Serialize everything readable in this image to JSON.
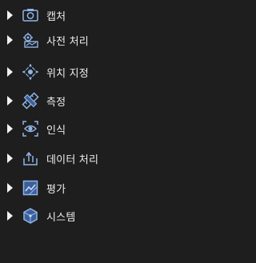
{
  "tree": {
    "items": [
      {
        "label": "캡처",
        "icon": "camera-icon"
      },
      {
        "label": "사전 처리",
        "icon": "preprocess-icon"
      },
      {
        "label": "위치 지정",
        "icon": "locate-icon"
      },
      {
        "label": "측정",
        "icon": "measure-icon"
      },
      {
        "label": "인식",
        "icon": "eye-icon"
      },
      {
        "label": "데이터 처리",
        "icon": "data-export-icon"
      },
      {
        "label": "평가",
        "icon": "evaluate-icon"
      },
      {
        "label": "시스템",
        "icon": "system-icon"
      }
    ]
  },
  "colors": {
    "background": "#1e1e1e",
    "text": "#ebebeb",
    "icon_stroke": "#8fb3e6",
    "icon_fill": "#3c5f99",
    "arrow": "#f2f2f2"
  }
}
